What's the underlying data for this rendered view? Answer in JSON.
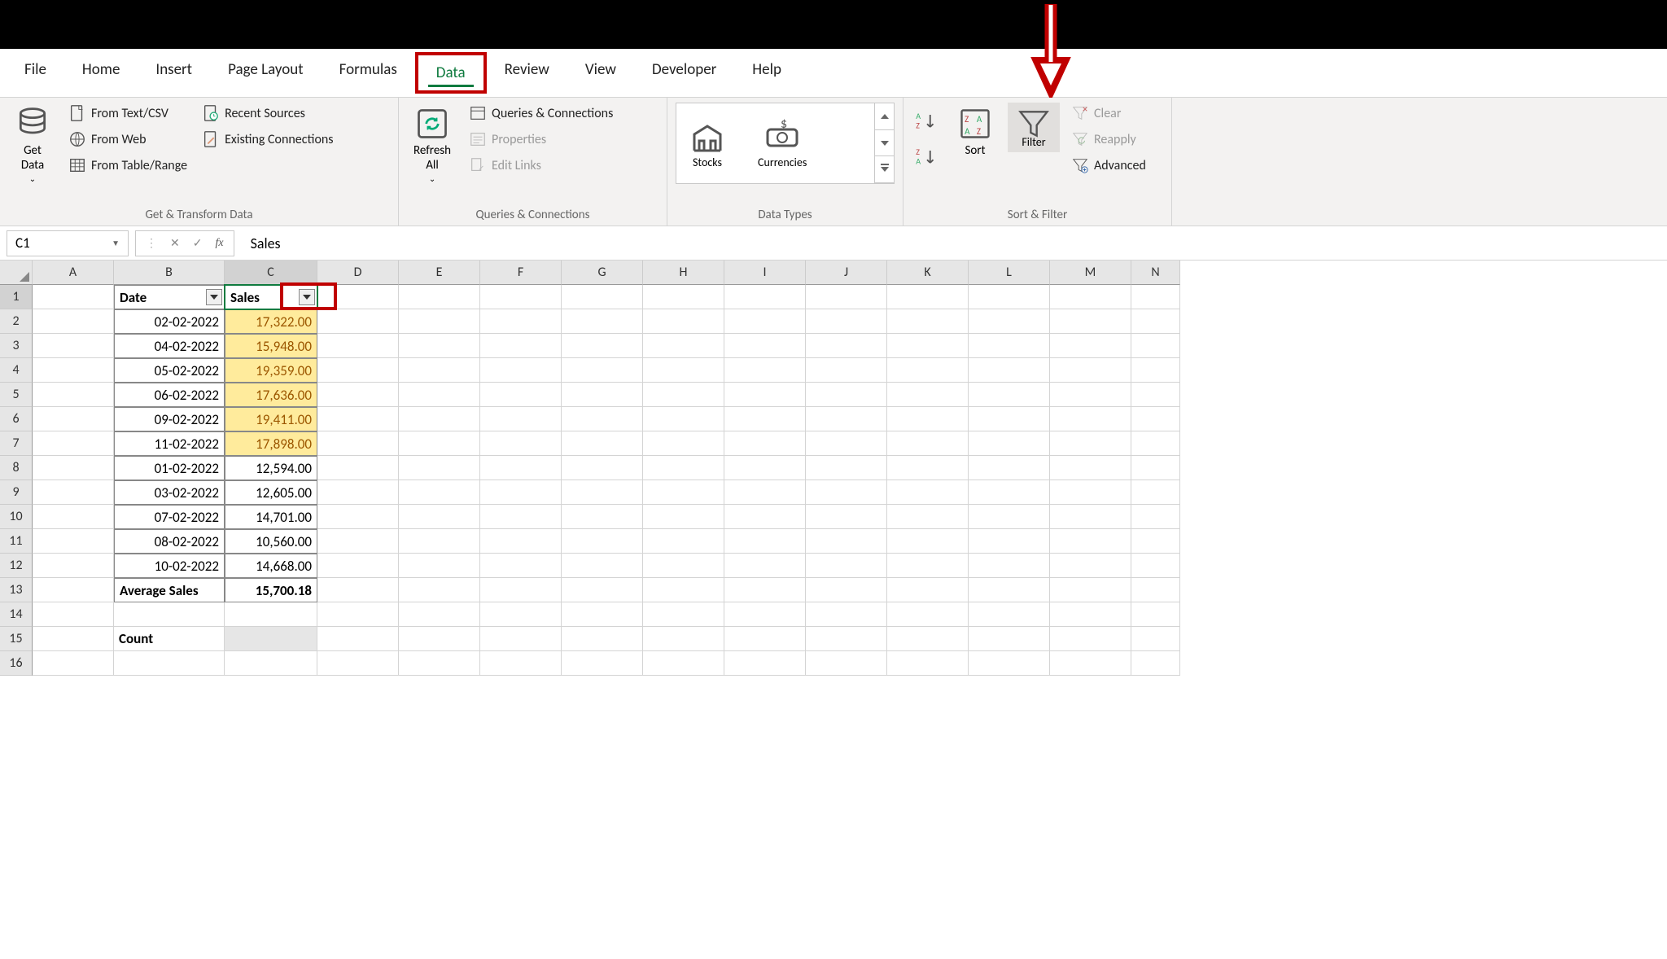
{
  "tabs": {
    "file": "File",
    "home": "Home",
    "insert": "Insert",
    "pagelayout": "Page Layout",
    "formulas": "Formulas",
    "data": "Data",
    "review": "Review",
    "view": "View",
    "developer": "Developer",
    "help": "Help"
  },
  "ribbon": {
    "getdata": "Get\nData",
    "fromcsv": "From Text/CSV",
    "fromweb": "From Web",
    "fromtable": "From Table/Range",
    "recent": "Recent Sources",
    "existconn": "Existing Connections",
    "refresh": "Refresh\nAll",
    "queries": "Queries & Connections",
    "properties": "Properties",
    "editlinks": "Edit Links",
    "stocks": "Stocks",
    "currencies": "Currencies",
    "sort": "Sort",
    "filter": "Filter",
    "clear": "Clear",
    "reapply": "Reapply",
    "advanced": "Advanced",
    "grp_get": "Get & Transform Data",
    "grp_qc": "Queries & Connections",
    "grp_dt": "Data Types",
    "grp_sf": "Sort & Filter"
  },
  "namebox": "C1",
  "formula": "Sales",
  "columns": [
    "A",
    "B",
    "C",
    "D",
    "E",
    "F",
    "G",
    "H",
    "I",
    "J",
    "K",
    "L",
    "M",
    "N"
  ],
  "row_numbers": [
    "1",
    "2",
    "3",
    "4",
    "5",
    "6",
    "7",
    "8",
    "9",
    "10",
    "11",
    "12",
    "13",
    "14",
    "15",
    "16"
  ],
  "headers": {
    "date": "Date",
    "sales": "Sales"
  },
  "data_rows": [
    {
      "date": "02-02-2022",
      "sales": "17,322.00",
      "hl": true
    },
    {
      "date": "04-02-2022",
      "sales": "15,948.00",
      "hl": true
    },
    {
      "date": "05-02-2022",
      "sales": "19,359.00",
      "hl": true
    },
    {
      "date": "06-02-2022",
      "sales": "17,636.00",
      "hl": true
    },
    {
      "date": "09-02-2022",
      "sales": "19,411.00",
      "hl": true
    },
    {
      "date": "11-02-2022",
      "sales": "17,898.00",
      "hl": true
    },
    {
      "date": "01-02-2022",
      "sales": "12,594.00",
      "hl": false
    },
    {
      "date": "03-02-2022",
      "sales": "12,605.00",
      "hl": false
    },
    {
      "date": "07-02-2022",
      "sales": "14,701.00",
      "hl": false
    },
    {
      "date": "08-02-2022",
      "sales": "10,560.00",
      "hl": false
    },
    {
      "date": "10-02-2022",
      "sales": "14,668.00",
      "hl": false
    }
  ],
  "summary": {
    "avglabel": "Average Sales",
    "avgval": "15,700.18",
    "countlabel": "Count"
  },
  "chart_data": {
    "type": "table",
    "title": "Sales",
    "columns": [
      "Date",
      "Sales"
    ],
    "rows": [
      [
        "02-02-2022",
        17322.0
      ],
      [
        "04-02-2022",
        15948.0
      ],
      [
        "05-02-2022",
        19359.0
      ],
      [
        "06-02-2022",
        17636.0
      ],
      [
        "09-02-2022",
        19411.0
      ],
      [
        "11-02-2022",
        17898.0
      ],
      [
        "01-02-2022",
        12594.0
      ],
      [
        "03-02-2022",
        12605.0
      ],
      [
        "07-02-2022",
        14701.0
      ],
      [
        "08-02-2022",
        10560.0
      ],
      [
        "10-02-2022",
        14668.0
      ]
    ],
    "summary": {
      "Average Sales": 15700.18
    }
  }
}
